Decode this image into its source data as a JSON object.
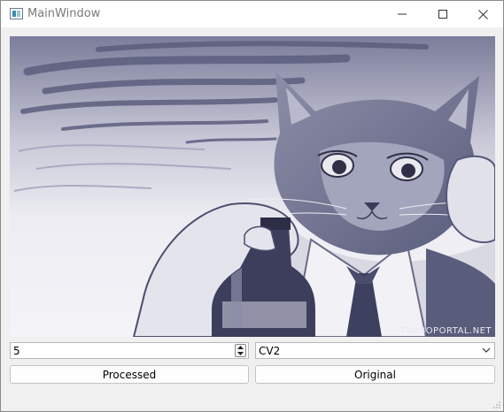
{
  "window": {
    "title": "MainWindow"
  },
  "icons": {
    "app": "app-window-icon",
    "minimize": "minimize-icon",
    "maximize": "maximize-icon",
    "close": "close-icon",
    "spin_up": "chevron-up-icon",
    "spin_down": "chevron-down-icon",
    "combo": "chevron-down-icon",
    "grip": "resize-grip-icon"
  },
  "image": {
    "watermark": "TURBOPORTAL.NET"
  },
  "controls": {
    "spin_value": "5",
    "combo_value": "CV2",
    "processed_label": "Processed",
    "original_label": "Original"
  },
  "colors": {
    "image_tint": "#4a4c6e",
    "image_light": "#e6e6ee",
    "window_bg": "#f0f0f0"
  }
}
